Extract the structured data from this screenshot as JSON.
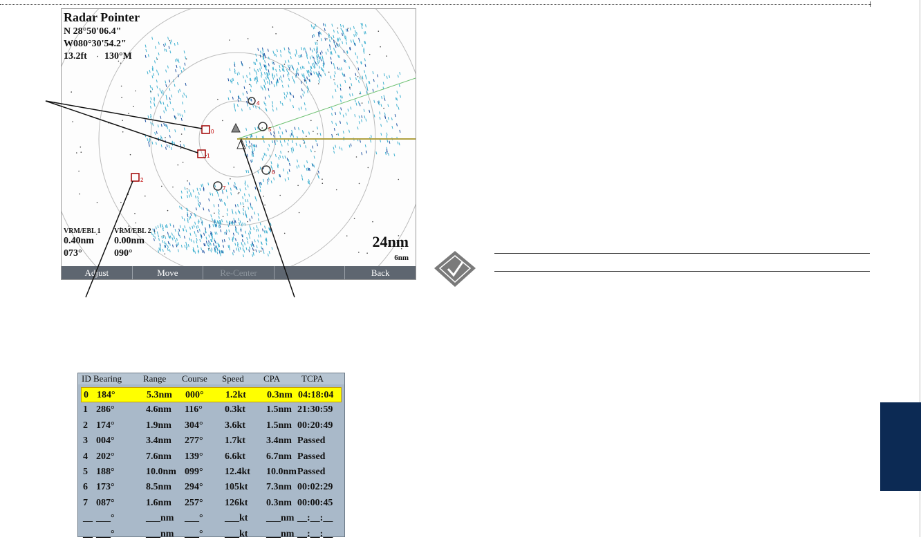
{
  "radar": {
    "title": "Radar Pointer",
    "lat": "N 28°50'06.4\"",
    "lon": "W080°30'54.2\"",
    "dist": "13.2ft",
    "brg": "130°M",
    "vrm1_label": "VRM/EBL 1",
    "vrm1_range": "0.40nm",
    "vrm1_brg": "073°",
    "vrm2_label": "VRM/EBL 2",
    "vrm2_range": "0.00nm",
    "vrm2_brg": "090°",
    "range": "24nm",
    "ring": "6nm",
    "softkeys": [
      "Adjust",
      "Move",
      "Re-Center",
      "",
      "Back"
    ],
    "target_labels": [
      "0",
      "1",
      "2",
      "3",
      "4",
      "5",
      "6",
      "7"
    ]
  },
  "table": {
    "headers": [
      "ID",
      "Bearing",
      "Range",
      "Course",
      "Speed",
      "CPA",
      "TCPA"
    ],
    "rows": [
      [
        "0",
        "184°",
        "5.3nm",
        "000°",
        "1.2kt",
        "0.3nm",
        "04:18:04"
      ],
      [
        "1",
        "286°",
        "4.6nm",
        "116°",
        "0.3kt",
        "1.5nm",
        "21:30:59"
      ],
      [
        "2",
        "174°",
        "1.9nm",
        "304°",
        "3.6kt",
        "1.5nm",
        "00:20:49"
      ],
      [
        "3",
        "004°",
        "3.4nm",
        "277°",
        "1.7kt",
        "3.4nm",
        "Passed"
      ],
      [
        "4",
        "202°",
        "7.6nm",
        "139°",
        "6.6kt",
        "6.7nm",
        "Passed"
      ],
      [
        "5",
        "188°",
        "10.0nm",
        "099°",
        "12.4kt",
        "10.0nm",
        "Passed"
      ],
      [
        "6",
        "173°",
        "8.5nm",
        "294°",
        "105kt",
        "7.3nm",
        "00:02:29"
      ],
      [
        "7",
        "087°",
        "1.6nm",
        "257°",
        "126kt",
        "0.3nm",
        "00:00:45"
      ],
      [
        "__",
        "___°",
        "___nm",
        "___°",
        "___kt",
        "___nm",
        "__:__:__"
      ],
      [
        "__",
        "___°",
        "___nm",
        "___°",
        "___kt",
        "___nm",
        "__:__:__"
      ]
    ]
  },
  "colors": {
    "tab": "#0c2a54",
    "highlight": "#ffff00",
    "radar_return": "#3fb0d0"
  }
}
